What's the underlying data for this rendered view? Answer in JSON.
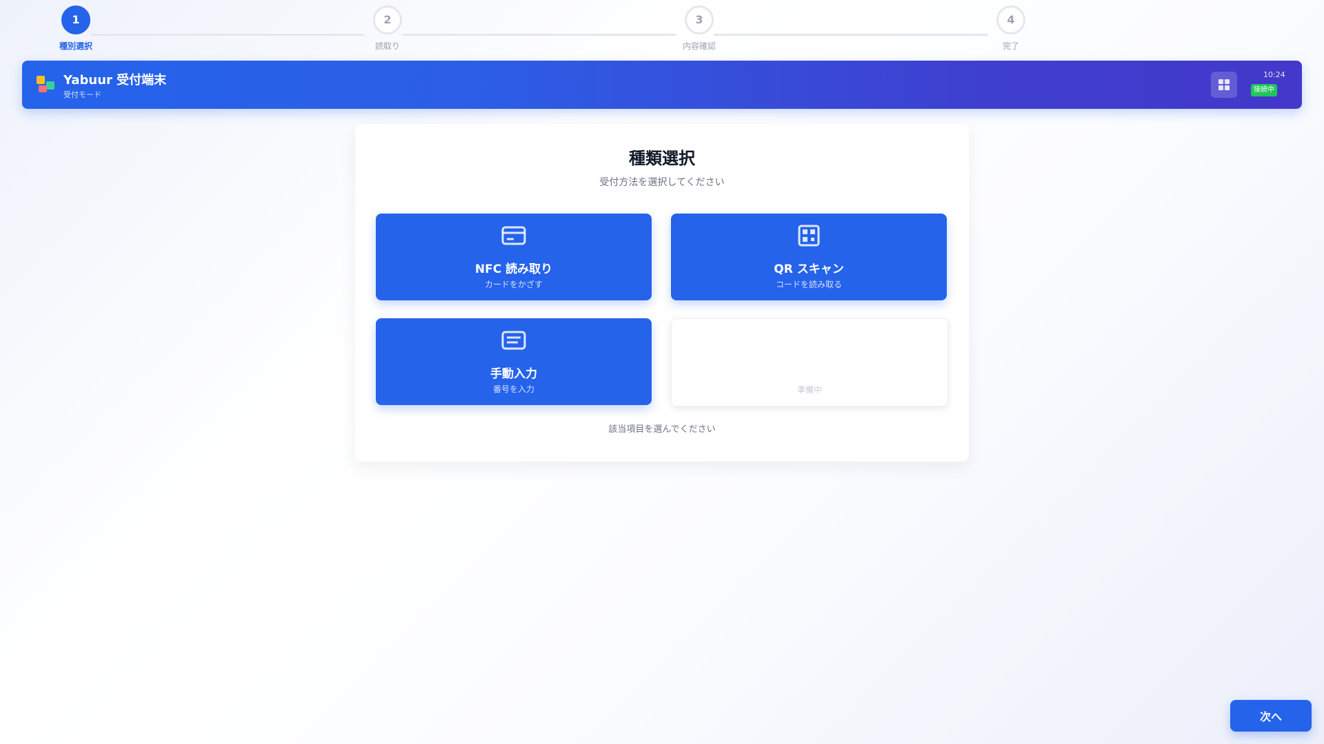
{
  "stepper": {
    "steps": [
      {
        "number": "1",
        "label": "種別選択"
      },
      {
        "number": "2",
        "label": "読取り"
      },
      {
        "number": "3",
        "label": "内容確認"
      },
      {
        "number": "4",
        "label": "完了"
      }
    ],
    "active_index": 0
  },
  "header": {
    "title": "Yabuur 受付端末",
    "subtitle": "受付モード",
    "time": "10:24",
    "status_badge": "接続中"
  },
  "main": {
    "title": "種類選択",
    "subtitle": "受付方法を選択してください",
    "options": [
      {
        "title": "NFC 読み取り",
        "subtitle": "カードをかざす",
        "icon": "card-icon"
      },
      {
        "title": "QR スキャン",
        "subtitle": "コードを読み取る",
        "icon": "qr-code-icon"
      },
      {
        "title": "手動入力",
        "subtitle": "番号を入力",
        "icon": "keyboard-icon"
      },
      {
        "title": "",
        "subtitle": "準備中",
        "icon": ""
      }
    ],
    "note": "該当項目を選んでください"
  },
  "footer": {
    "next_label": "次へ"
  },
  "colors": {
    "primary": "#2563eb",
    "header_end": "#4338ca",
    "success": "#22c55e"
  }
}
